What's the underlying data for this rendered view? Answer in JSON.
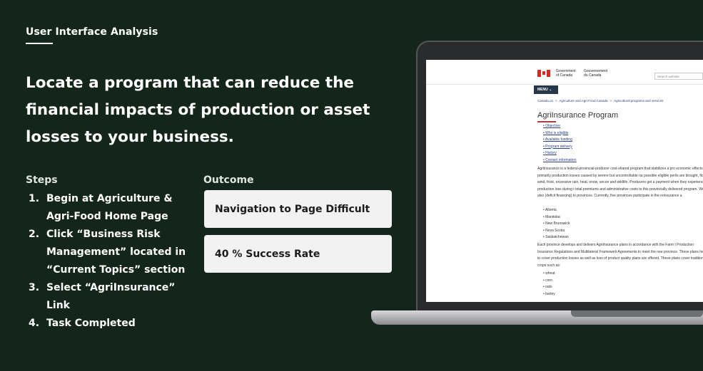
{
  "section_label": "User Interface Analysis",
  "headline": "Locate a program that can reduce the financial impacts of production or asset losses to your business.",
  "steps": {
    "heading": "Steps",
    "items": [
      {
        "num": "1.",
        "text": "Begin at Agriculture & Agri-Food Home Page"
      },
      {
        "num": "2.",
        "text": "Click “Business Risk Management” located in “Current Topics” section"
      },
      {
        "num": "3.",
        "text": "Select “AgriInsurance” Link"
      },
      {
        "num": "4.",
        "text": "Task Completed"
      }
    ]
  },
  "outcome": {
    "heading": "Outcome",
    "items": [
      "Navigation to Page Difficult",
      "40 % Success Rate"
    ]
  },
  "screen": {
    "gov_en": [
      "Government",
      "of Canada"
    ],
    "gov_fr": [
      "Gouvernement",
      "du Canada"
    ],
    "search_placeholder": "Search website",
    "menu_label": "MENU ⌄",
    "breadcrumb": [
      "Canada.ca",
      "Agriculture and Agri-Food Canada",
      "Agricultural programs and services"
    ],
    "page_title": "AgriInsurance Program",
    "toc": [
      "Objective",
      "Who is eligible",
      "Available funding",
      "Program delivery",
      "History",
      "Contact information"
    ],
    "para1": "AgriInsurance is a federal-provincial-producer cost-shared program that stabilizes a pro economic effects of primarily production losses caused by severe but uncontrollable na possible eligible perils are drought, flood, wind, frost, excessive rain, heat, snow, uncon and wildlife. Producers get a payment when they experience a production loss during t total premiums and administrative costs to this provincially delivered program. We also (deficit financing) to provinces. Currently, five provinces participate in the reinsurance a",
    "provinces": [
      "Alberta",
      "Manitoba",
      "New Brunswick",
      "Nova Scotia",
      "Saskatchewan"
    ],
    "para2": "Each province develops and delivers AgriInsurance plans in accordance with the Farm I Production Insurance Regulations and Multilateral Framework Agreements to meet the nee province. These plans help to cover production losses as well as loss of product quality plans are offered. These plans cover traditional crops such as:",
    "crops": [
      "wheat",
      "corn",
      "oats",
      "barley"
    ]
  }
}
